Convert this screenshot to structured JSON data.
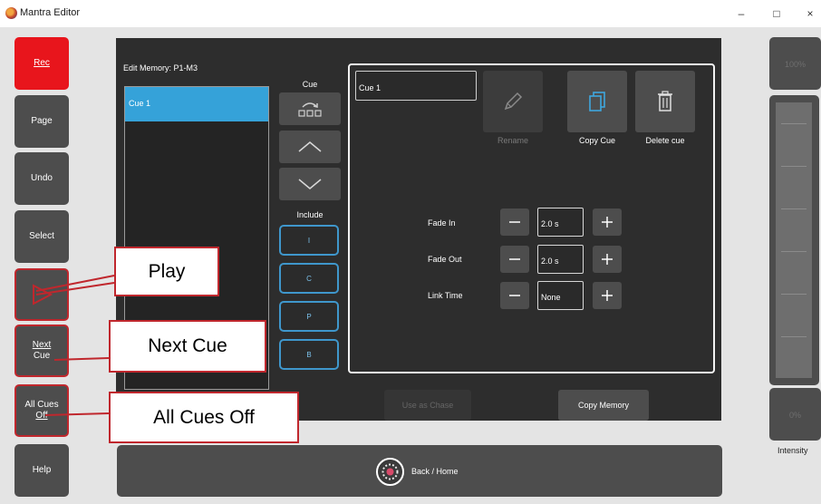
{
  "window": {
    "title": "Mantra Editor",
    "minimize_glyph": "–",
    "maximize_glyph": "□",
    "close_glyph": "×"
  },
  "sidebar": {
    "items": [
      {
        "label": "Rec",
        "color": "#e8151c"
      },
      {
        "label": "Page"
      },
      {
        "label": "Undo"
      },
      {
        "label": "Select"
      },
      {
        "label": ""
      },
      {
        "label": "Next",
        "label2": "Cue"
      },
      {
        "label": "All Cues",
        "label2": "Off"
      },
      {
        "label": "Help"
      }
    ]
  },
  "editor": {
    "title": "Edit Memory: P1-M3",
    "cue_list": [
      "Cue 1"
    ],
    "cue_column_label": "Cue",
    "include_label": "Include",
    "include_buttons": [
      "I",
      "C",
      "P",
      "B"
    ],
    "cue_name_value": "Cue 1",
    "actions": [
      {
        "label": "Rename",
        "icon": "pencil-icon",
        "enabled": false
      },
      {
        "label": "Copy Cue",
        "icon": "copy-icon",
        "enabled": true
      },
      {
        "label": "Delete cue",
        "icon": "trash-icon",
        "enabled": true
      }
    ],
    "fields": [
      {
        "label": "Fade In",
        "value": "2.0 s"
      },
      {
        "label": "Fade Out",
        "value": "2.0 s"
      },
      {
        "label": "Link Time",
        "value": "None"
      }
    ],
    "bottom_buttons": {
      "use_as_chase": "Use as Chase",
      "copy_memory": "Copy Memory"
    },
    "back_home": "Back / Home"
  },
  "right_panel": {
    "top_value": "100%",
    "bottom_value": "0%",
    "intensity_label": "Intensity",
    "level": 0.0
  },
  "callouts": {
    "play": "Play",
    "next_cue": "Next Cue",
    "all_cues_off": "All Cues Off"
  },
  "colors": {
    "accent_blue": "#35a2d9",
    "rec_red": "#e8151c",
    "callout_red": "#c0272d",
    "button_gray": "#4d4d4d",
    "panel_dark": "#2d2d2d"
  }
}
